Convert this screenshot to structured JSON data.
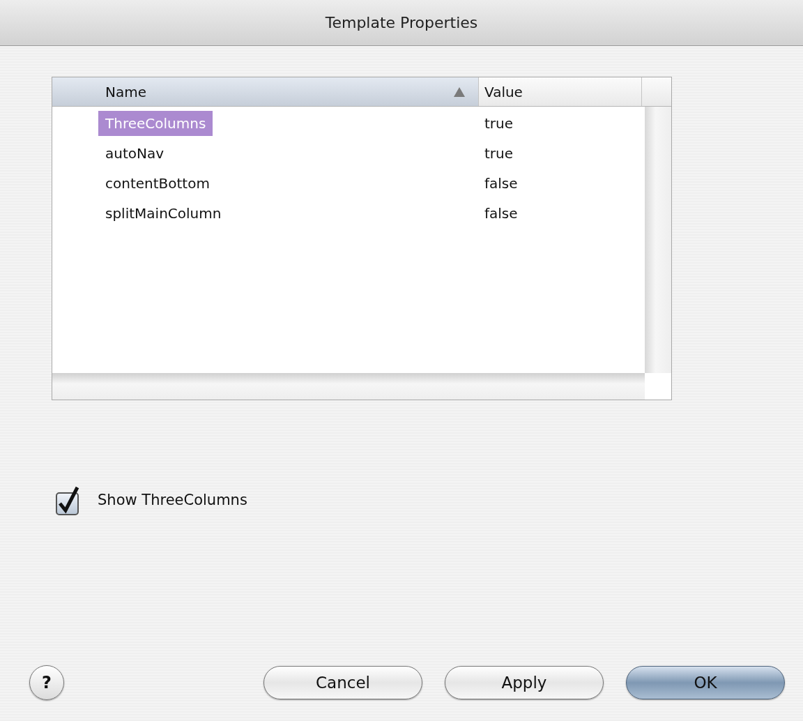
{
  "window": {
    "title": "Template Properties"
  },
  "table": {
    "columns": [
      {
        "label": "Name",
        "sorted": true
      },
      {
        "label": "Value",
        "sorted": false
      }
    ],
    "rows": [
      {
        "name": "ThreeColumns",
        "value": "true",
        "selected": true
      },
      {
        "name": "autoNav",
        "value": "true",
        "selected": false
      },
      {
        "name": "contentBottom",
        "value": "false",
        "selected": false
      },
      {
        "name": "splitMainColumn",
        "value": "false",
        "selected": false
      }
    ]
  },
  "checkbox": {
    "label": "Show ThreeColumns",
    "checked": true
  },
  "help": {
    "label": "?"
  },
  "buttons": [
    {
      "label": "Cancel",
      "default": false
    },
    {
      "label": "Apply",
      "default": false
    },
    {
      "label": "OK",
      "default": true
    }
  ]
}
